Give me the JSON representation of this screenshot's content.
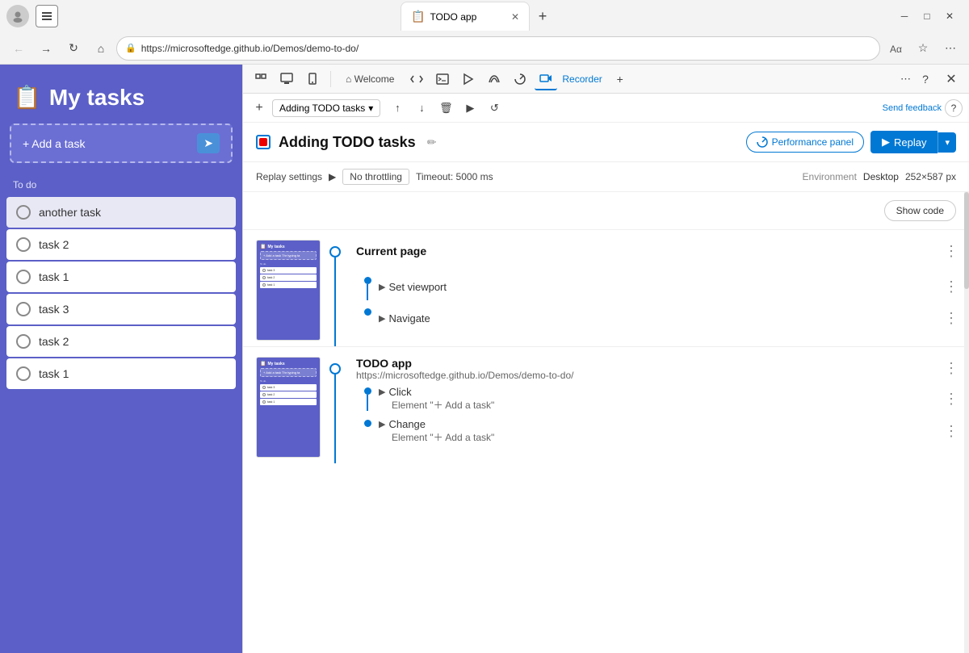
{
  "browser": {
    "title": "TODO app",
    "url": "https://microsoftedge.github.io/Demos/demo-to-do/",
    "tab_label": "TODO app"
  },
  "devtools": {
    "toolbar_tools": [
      "select",
      "inspect",
      "console",
      "sources",
      "network",
      "performance",
      "recorder",
      "add"
    ],
    "tabs": [
      "Welcome",
      "Code",
      "Console",
      "Debugger",
      "Network",
      "Performance",
      "Recorder"
    ],
    "active_tab": "Recorder",
    "close_label": "×",
    "send_feedback": "Send feedback",
    "help": "?"
  },
  "recorder": {
    "add_label": "+",
    "recording_name": "Adding TODO tasks",
    "replay_label": "Replay",
    "perf_panel_label": "Performance panel",
    "show_code_label": "Show code",
    "settings": {
      "label": "Replay settings",
      "throttle": "No throttling",
      "timeout": "Timeout: 5000 ms"
    },
    "environment": {
      "label": "Environment",
      "type": "Desktop",
      "size": "252×587 px"
    }
  },
  "todo_app": {
    "title": "My tasks",
    "add_button": "+ Add a task",
    "section": "To do",
    "tasks": [
      {
        "label": "another task"
      },
      {
        "label": "task 2"
      },
      {
        "label": "task 1"
      },
      {
        "label": "task 3"
      },
      {
        "label": "task 2"
      },
      {
        "label": "task 1"
      }
    ]
  },
  "steps": [
    {
      "id": "step1",
      "title": "Current page",
      "subtitle": "",
      "sub_steps": [
        {
          "title": "Set viewport",
          "desc": ""
        },
        {
          "title": "Navigate",
          "desc": ""
        }
      ]
    },
    {
      "id": "step2",
      "title": "TODO app",
      "subtitle": "https://microsoftedge.github.io/Demos/demo-to-do/",
      "sub_steps": [
        {
          "title": "Click",
          "desc": "Element \"＋ Add a task\""
        },
        {
          "title": "Change",
          "desc": "Element \"＋ Add a task\""
        }
      ]
    }
  ]
}
